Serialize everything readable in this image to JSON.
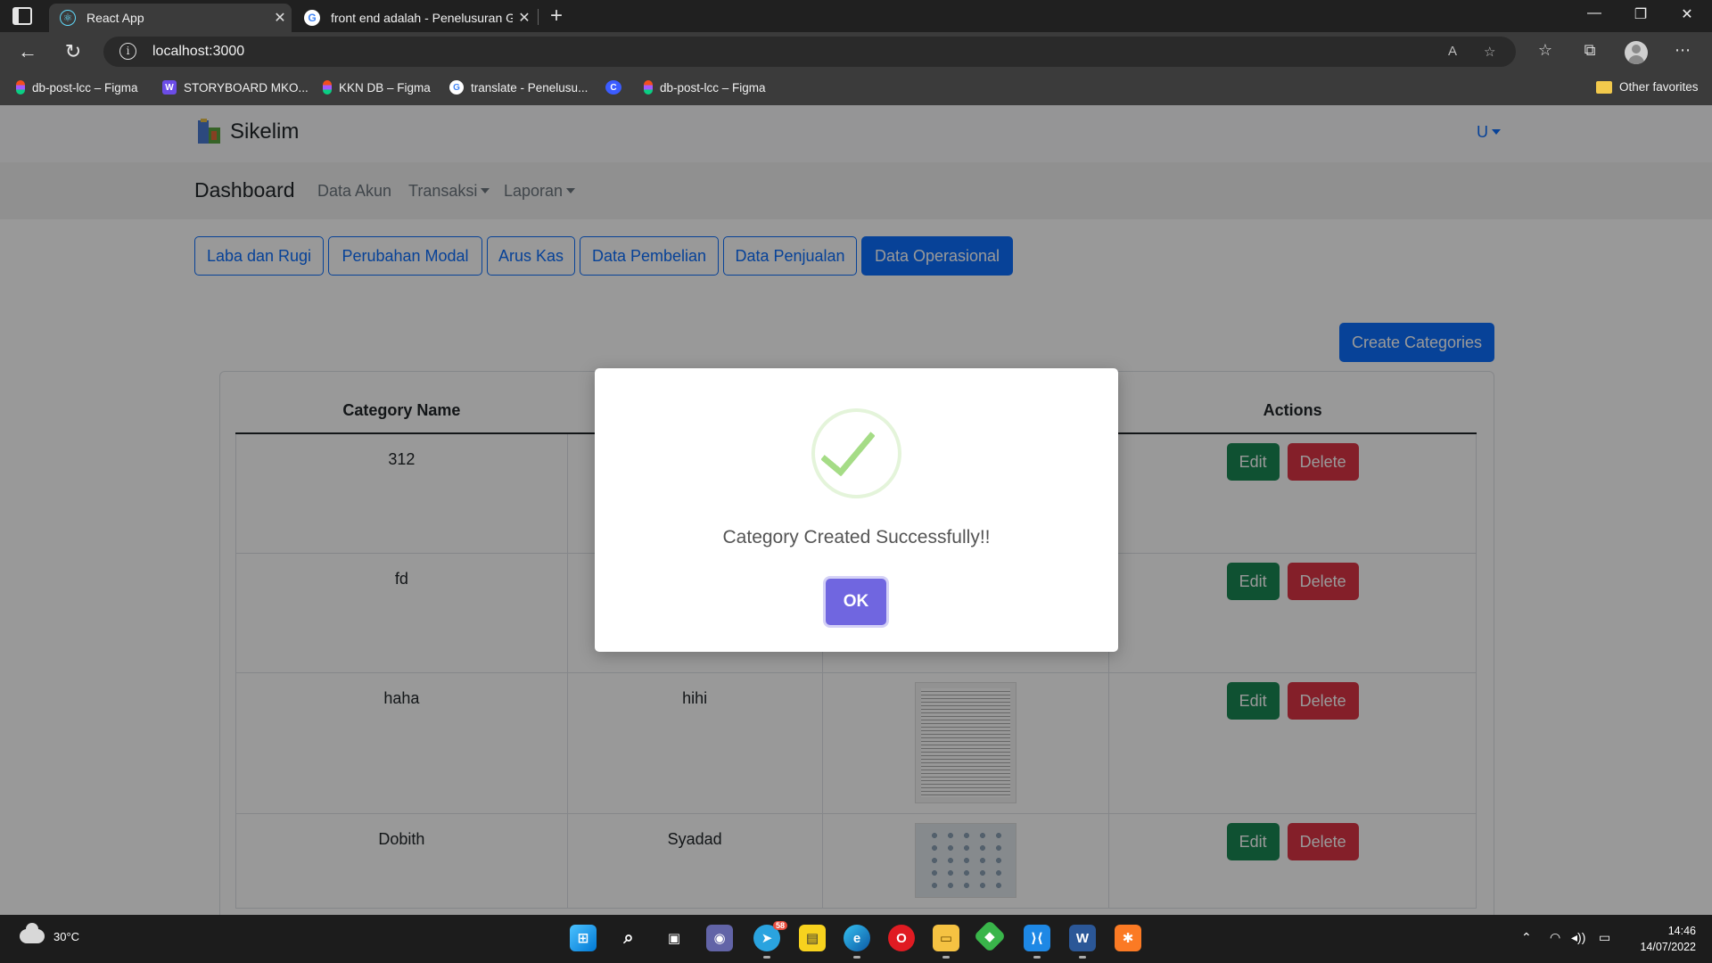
{
  "browser": {
    "tabs": [
      {
        "title": "React App",
        "active": true
      },
      {
        "title": "front end adalah - Penelusuran G",
        "active": false
      }
    ],
    "new_tab_symbol": "+",
    "close_symbol": "✕",
    "address": "localhost:3000",
    "read_aloud_icon": "A",
    "bookmarks": [
      {
        "label": "db-post-lcc – Figma",
        "icon": "figma"
      },
      {
        "label": "STORYBOARD MKO...",
        "icon": "w"
      },
      {
        "label": "KKN DB – Figma",
        "icon": "figma"
      },
      {
        "label": "translate - Penelusu...",
        "icon": "google"
      },
      {
        "label": "",
        "icon": "c"
      },
      {
        "label": "db-post-lcc – Figma",
        "icon": "figma"
      }
    ],
    "other_favorites": "Other favorites"
  },
  "app": {
    "brand": "Sikelim",
    "user_menu": "U",
    "subnav": {
      "title": "Dashboard",
      "links": [
        "Data Akun",
        "Transaksi",
        "Laporan"
      ]
    },
    "pills": [
      "Laba dan Rugi",
      "Perubahan Modal",
      "Arus Kas",
      "Data Pembelian",
      "Data Penjualan",
      "Data Operasional"
    ],
    "active_pill": "Data Operasional",
    "create_button": "Create Categories",
    "table": {
      "headers": {
        "name": "Category Name",
        "actions": "Actions"
      },
      "rows": [
        {
          "name": "312",
          "desc": "",
          "image": "none"
        },
        {
          "name": "fd",
          "desc": "",
          "image": "none"
        },
        {
          "name": "haha",
          "desc": "hihi",
          "image": "code-screenshot"
        },
        {
          "name": "Dobith",
          "desc": "Syadad",
          "image": "diagram"
        }
      ],
      "edit_label": "Edit",
      "delete_label": "Delete"
    }
  },
  "modal": {
    "message": "Category Created Successfully!!",
    "ok_label": "OK",
    "icon": "success-check-icon"
  },
  "taskbar": {
    "weather": "30°C",
    "apps": [
      "start",
      "search",
      "task-view",
      "teams-chat",
      "telegram",
      "sticky-notes",
      "edge",
      "opera",
      "file-explorer",
      "git",
      "vscode",
      "word",
      "xampp"
    ],
    "telegram_badge": "58",
    "time": "14:46",
    "date": "14/07/2022"
  },
  "colors": {
    "primary": "#0d6efd",
    "success": "#198754",
    "danger": "#dc3545",
    "swal_confirm": "#7066e0",
    "swal_success": "#a5dc86"
  }
}
